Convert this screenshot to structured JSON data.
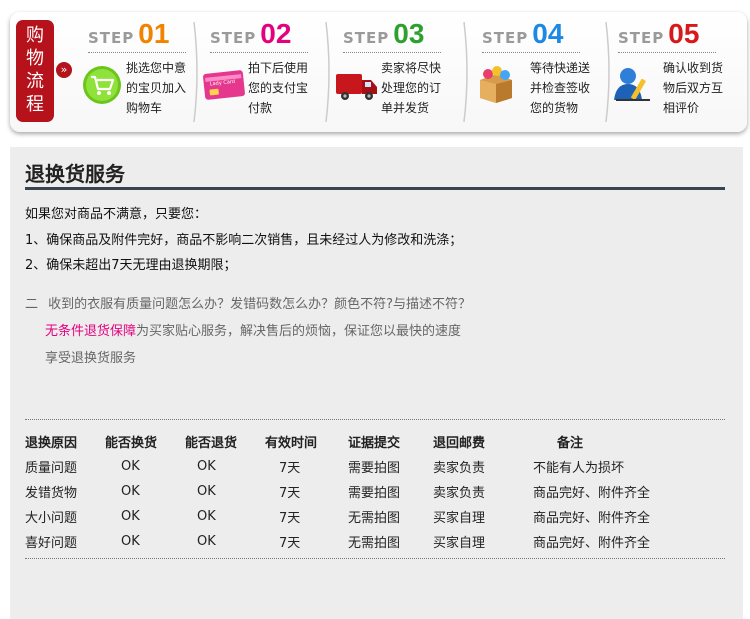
{
  "process": {
    "badge_label": [
      "购",
      "物",
      "流",
      "程"
    ],
    "arrow_glyph": "»",
    "step_word": "STEP",
    "steps": [
      {
        "num": "01",
        "color": "#f08300",
        "icon": "shopping-cart-icon",
        "lines": [
          "挑选您中意",
          "的宝贝加入",
          "购物车"
        ]
      },
      {
        "num": "02",
        "color": "#e4007f",
        "icon": "payment-card-icon",
        "lines": [
          "拍下后使用",
          "您的支付宝",
          "付款"
        ]
      },
      {
        "num": "03",
        "color": "#2da12d",
        "icon": "delivery-truck-icon",
        "lines": [
          "卖家将尽快",
          "处理您的订",
          "单并发货"
        ]
      },
      {
        "num": "04",
        "color": "#1e88e5",
        "icon": "package-box-icon",
        "lines": [
          "等待快递送",
          "并检查签收",
          "您的货物"
        ]
      },
      {
        "num": "05",
        "color": "#d7191b",
        "icon": "user-review-icon",
        "lines": [
          "确认收到货",
          "物后双方互",
          "相评价"
        ]
      }
    ],
    "card_text": "Lady Card"
  },
  "service": {
    "title": "退换货服务",
    "intro": "如果您对商品不满意，只要您：",
    "rule1": "1、确保商品及附件完好，商品不影响二次销售，且未经过人为修改和洗涤；",
    "rule2": "2、确保未超出7天无理由退换期限；",
    "q_prefix": "二",
    "q_line1": "收到的衣服有质量问题怎么办？发错码数怎么办？颜色不符?与描述不符？",
    "q_highlight": "无条件退货保障",
    "q_line2": "为买家贴心服务，解决售后的烦恼，保证您以最快的速度",
    "q_line3": "享受退换货服务",
    "highlight_color": "#e4007f"
  },
  "table": {
    "headers": [
      "退换原因",
      "能否换货",
      "能否退货",
      "有效时间",
      "证据提交",
      "退回邮费",
      "备注"
    ],
    "rows": [
      [
        "质量问题",
        "OK",
        "OK",
        "7天",
        "需要拍图",
        "卖家负责",
        "不能有人为损坏"
      ],
      [
        "发错货物",
        "OK",
        "OK",
        "7天",
        "需要拍图",
        "卖家负责",
        "商品完好、附件齐全"
      ],
      [
        "大小问题",
        "OK",
        "OK",
        "7天",
        "无需拍图",
        "买家自理",
        "商品完好、附件齐全"
      ],
      [
        "喜好问题",
        "OK",
        "OK",
        "7天",
        "无需拍图",
        "买家自理",
        "商品完好、附件齐全"
      ]
    ]
  }
}
